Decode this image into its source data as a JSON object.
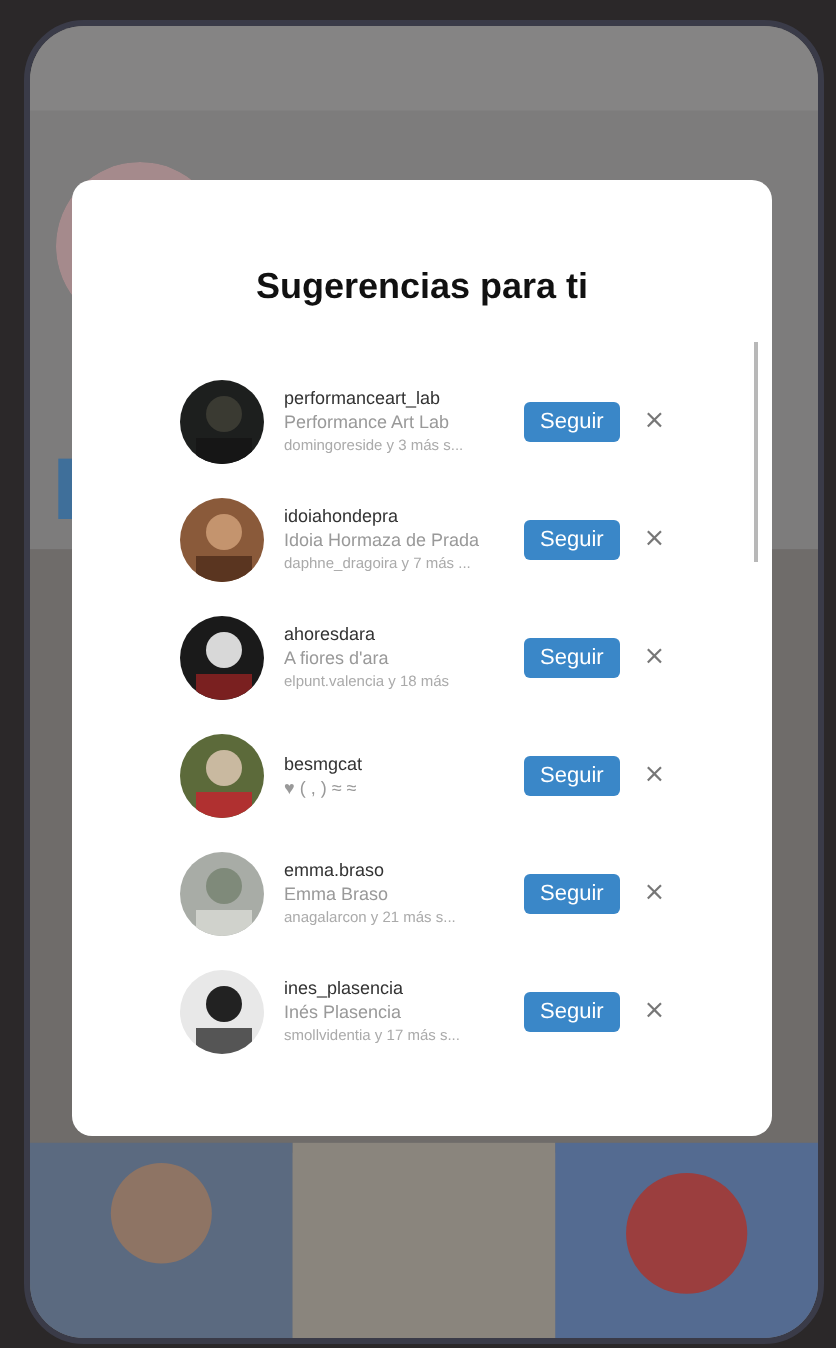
{
  "dialog": {
    "title": "Sugerencias para ti"
  },
  "suggestions": [
    {
      "username": "performanceart_lab",
      "name": "Performance Art Lab",
      "mutual": "domingoreside y 3 más s...",
      "button": "Seguir",
      "dismiss": "×"
    },
    {
      "username": "idoiahondepra",
      "name": "Idoia Hormaza de Prada",
      "mutual": "daphne_dragoira y 7 más ...",
      "button": "Seguir",
      "dismiss": "×"
    },
    {
      "username": "ahoresdara",
      "name": "A fiores d'ara",
      "mutual": "elpunt.valencia y 18 más",
      "button": "Seguir",
      "dismiss": "×"
    },
    {
      "username": "besmgcat",
      "name": "♥ ( , ) ≈ ≈",
      "button": "Seguir",
      "dismiss": "×"
    },
    {
      "username": "emma.braso",
      "name": "Emma Braso",
      "mutual": "anagalarcon y 21 más s...",
      "button": "Seguir",
      "dismiss": "×"
    },
    {
      "username": "ines_plasencia",
      "name": "Inés Plasencia",
      "mutual": "smollvidentia y 17 más s...",
      "button": "Seguir",
      "dismiss": "×"
    }
  ]
}
